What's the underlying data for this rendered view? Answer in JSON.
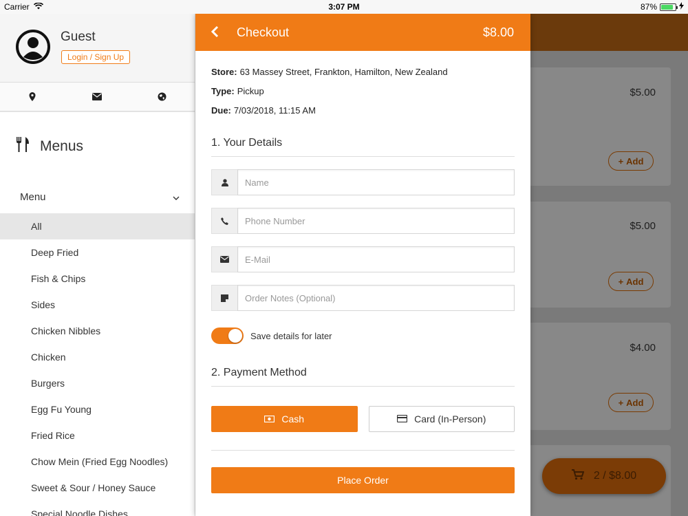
{
  "status_bar": {
    "carrier": "Carrier",
    "time": "3:07 PM",
    "battery": "87%"
  },
  "sidebar": {
    "profile": {
      "name": "Guest",
      "login_label": "Login / Sign Up"
    },
    "icons": [
      "location-icon",
      "mail-icon",
      "globe-icon"
    ],
    "menus_title": "Menus",
    "section_label": "Menu",
    "items": [
      "All",
      "Deep Fried",
      "Fish & Chips",
      "Sides",
      "Chicken Nibbles",
      "Chicken",
      "Burgers",
      "Egg Fu Young",
      "Fried Rice",
      "Chow Mein (Fried Egg Noodles)",
      "Sweet & Sour / Honey Sauce",
      "Special Noodle Dishes"
    ],
    "active_item": "All"
  },
  "checkout": {
    "title": "Checkout",
    "total": "$8.00",
    "store_label": "Store:",
    "store_value": "63 Massey Street, Frankton, Hamilton, New Zealand",
    "type_label": "Type:",
    "type_value": "Pickup",
    "due_label": "Due:",
    "due_value": "7/03/2018, 11:15 AM",
    "details_title": "1. Your Details",
    "fields": {
      "name_placeholder": "Name",
      "phone_placeholder": "Phone Number",
      "email_placeholder": "E-Mail",
      "notes_placeholder": "Order Notes (Optional)"
    },
    "save_details_label": "Save details for later",
    "save_details_on": true,
    "payment_title": "2. Payment Method",
    "payment_cash": "Cash",
    "payment_card": "Card (In-Person)",
    "selected_payment": "Cash",
    "place_order_label": "Place Order"
  },
  "background": {
    "prices": [
      "$5.00",
      "$5.00",
      "$4.00"
    ],
    "add_label": "Add",
    "cart_summary": "2 / $8.00"
  },
  "colors": {
    "accent": "#f07b16",
    "header_dim": "#6b3a0c"
  }
}
